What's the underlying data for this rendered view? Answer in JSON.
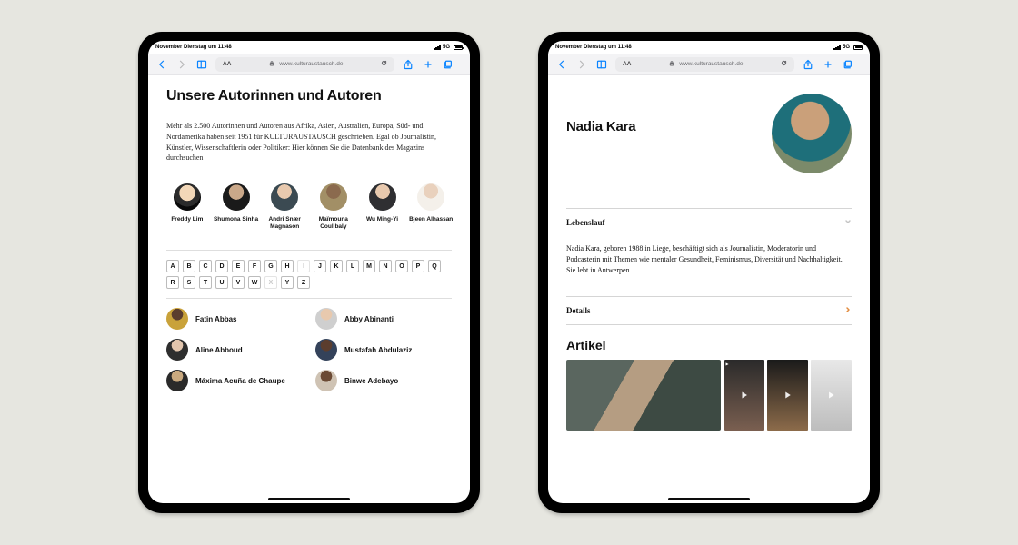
{
  "status": {
    "left": "November Dienstag um 11:48",
    "net": "5G"
  },
  "toolbar": {
    "url": "www.kulturaustausch.de",
    "aa": "AA"
  },
  "left": {
    "heading": "Unsere Autorinnen und Autoren",
    "intro": "Mehr als 2.500 Autorinnen und Autoren aus Afrika, Asien, Australien, Europa, Süd- und Nordamerika haben seit 1951 für KULTURAUSTAUSCH geschrieben. Egal ob Journalistin, Künstler, Wissenschaftlerin oder Politiker: Hier können Sie die Datenbank des Magazins durchsuchen",
    "featured": [
      {
        "name": "Freddy Lim"
      },
      {
        "name": "Shumona Sinha"
      },
      {
        "name": "Andri Snær Magnason"
      },
      {
        "name": "Maïmouna Coulibaly"
      },
      {
        "name": "Wu Ming-Yi"
      },
      {
        "name": "Bjeen Alhassan"
      }
    ],
    "alphabet": [
      "A",
      "B",
      "C",
      "D",
      "E",
      "F",
      "G",
      "H",
      "I",
      "J",
      "K",
      "L",
      "M",
      "N",
      "O",
      "P",
      "Q",
      "R",
      "S",
      "T",
      "U",
      "V",
      "W",
      "X",
      "Y",
      "Z"
    ],
    "alpha_disabled": [
      "I",
      "X"
    ],
    "results": [
      {
        "name": "Fatin Abbas"
      },
      {
        "name": "Abby Abinanti"
      },
      {
        "name": "Aline Abboud"
      },
      {
        "name": "Mustafah Abdulaziz"
      },
      {
        "name": "Máxima Acuña de Chaupe"
      },
      {
        "name": "Binwe Adebayo"
      }
    ]
  },
  "right": {
    "name": "Nadia Kara",
    "accordion_cv": "Lebenslauf",
    "bio": "Nadia Kara, geboren 1988 in Liege, beschäftigt sich als Journalistin, Moderatorin und Podcasterin mit Themen wie mentaler Gesundheit, Feminismus, Diversität und Nachhaltigkeit. Sie lebt in Antwerpen.",
    "accordion_details": "Details",
    "section_articles": "Artikel"
  }
}
